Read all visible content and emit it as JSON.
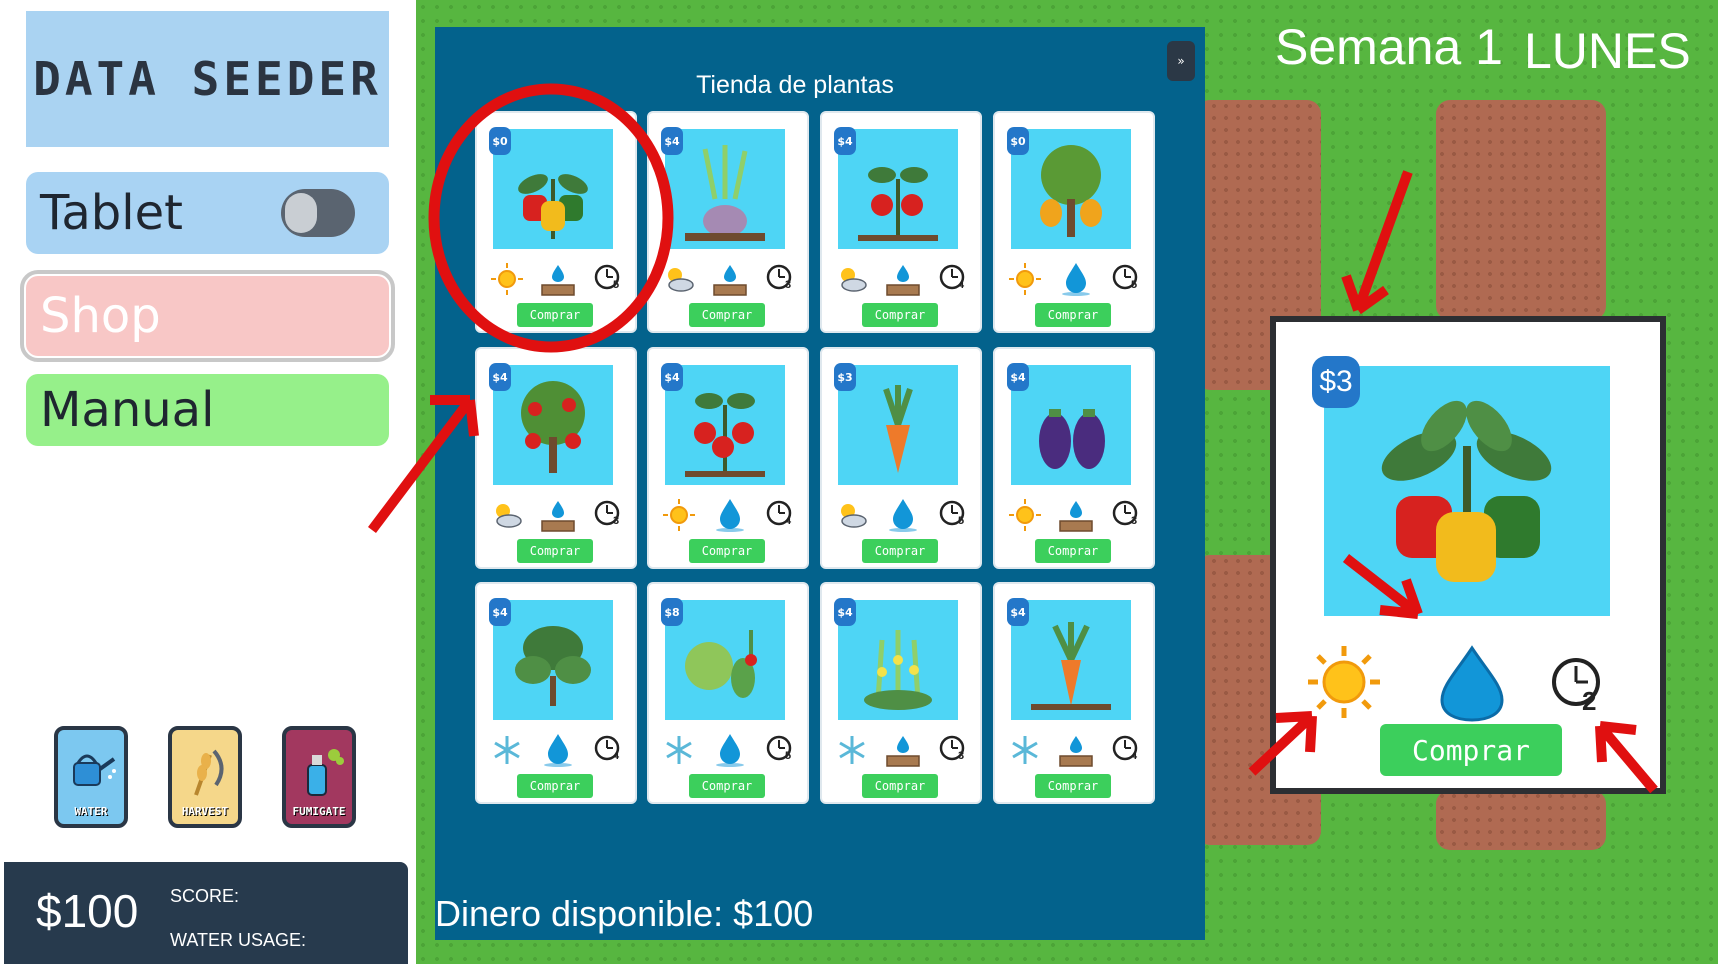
{
  "sidebar": {
    "logo": "DATA SEEDER",
    "tablet_label": "Tablet",
    "shop_label": "Shop",
    "manual_label": "Manual",
    "tools": [
      {
        "label": "WATER",
        "icon": "watering-can-icon"
      },
      {
        "label": "HARVEST",
        "icon": "wheat-sickle-icon"
      },
      {
        "label": "FUMIGATE",
        "icon": "spray-bottle-icon"
      }
    ],
    "money": "$100",
    "score_label": "SCORE:",
    "water_usage_label": "WATER USAGE:"
  },
  "header": {
    "week": "Semana 1",
    "day": "LUNES"
  },
  "shop": {
    "title": "Tienda de plantas",
    "close_label": "»",
    "buy_label": "Comprar",
    "money_available": "Dinero disponible:  $100",
    "cards": [
      {
        "price": "$0",
        "plant": "pepper",
        "sun": "sun",
        "water": "soil-drop",
        "days": "5"
      },
      {
        "price": "$4",
        "plant": "onion",
        "sun": "sun-cloud",
        "water": "soil-drop",
        "days": "3"
      },
      {
        "price": "$4",
        "plant": "tomato-small",
        "sun": "sun-cloud",
        "water": "soil-drop",
        "days": "4"
      },
      {
        "price": "$0",
        "plant": "orange-tree",
        "sun": "sun",
        "water": "drops",
        "days": "5"
      },
      {
        "price": "$4",
        "plant": "apple-tree",
        "sun": "sun-cloud",
        "water": "soil-drop",
        "days": "3"
      },
      {
        "price": "$4",
        "plant": "tomato",
        "sun": "sun",
        "water": "drops",
        "days": "4"
      },
      {
        "price": "$3",
        "plant": "carrot",
        "sun": "sun-cloud",
        "water": "drops",
        "days": "5"
      },
      {
        "price": "$4",
        "plant": "eggplant",
        "sun": "sun",
        "water": "soil-drop",
        "days": "3"
      },
      {
        "price": "$4",
        "plant": "basil",
        "sun": "snow",
        "water": "drops",
        "days": "4"
      },
      {
        "price": "$8",
        "plant": "cabbage",
        "sun": "snow",
        "water": "drops",
        "days": "5"
      },
      {
        "price": "$4",
        "plant": "flower",
        "sun": "snow",
        "water": "soil-drop",
        "days": "3"
      },
      {
        "price": "$4",
        "plant": "carrot2",
        "sun": "snow",
        "water": "soil-drop",
        "days": "4"
      }
    ]
  },
  "zoom": {
    "price": "$3",
    "buy_label": "Comprar",
    "days": "2"
  },
  "colors": {
    "annotation": "#e01010",
    "accent_green": "#3ccf5c",
    "price_blue": "#2477c9"
  }
}
